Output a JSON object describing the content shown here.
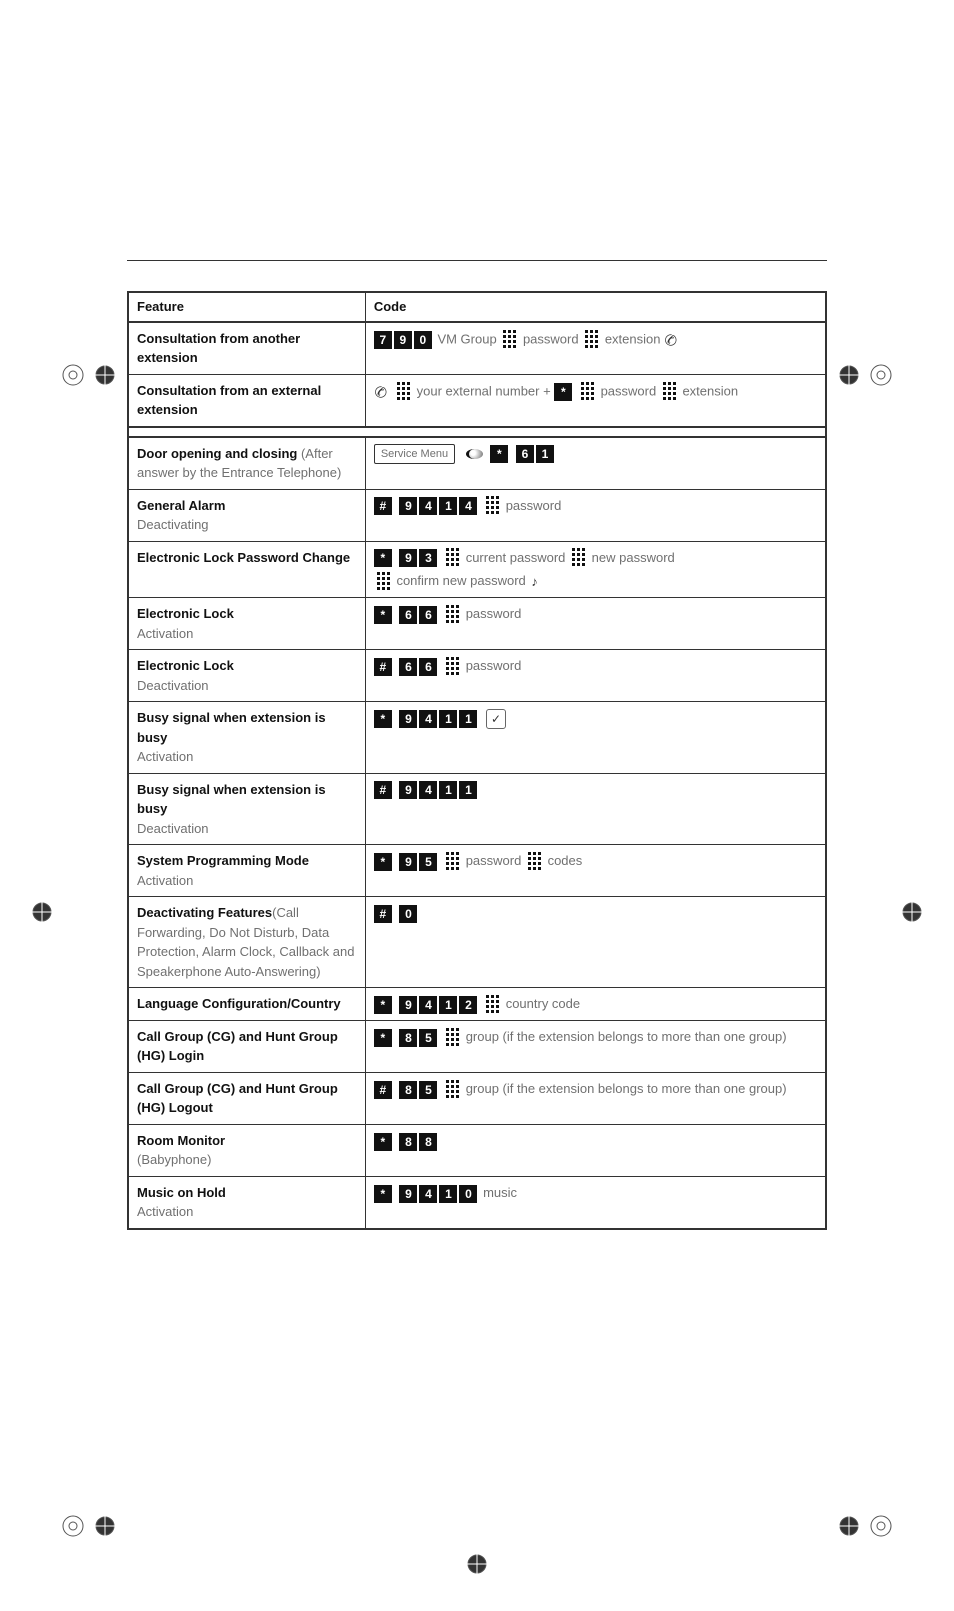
{
  "header": {
    "feature": "Feature",
    "code": "Code"
  },
  "labels": {
    "service_menu": "Service Menu",
    "password": "password"
  },
  "rows": [
    {
      "title": "Consultation from another extension",
      "t1": "VM Group",
      "t2": "password",
      "t3": "extension"
    },
    {
      "title": "Consultation from an external extension",
      "t1": "your external number +",
      "t2": "password",
      "t3": "extension"
    },
    {
      "title": "Door opening and closing",
      "sub": " (After answer by the Entrance Telephone)"
    },
    {
      "title": "General Alarm",
      "sub": "Deactivating"
    },
    {
      "title": "Electronic Lock Password Change",
      "t1": "current password",
      "t2": "new password",
      "t3": "confirm new password"
    },
    {
      "title": "Electronic Lock",
      "sub": "Activation"
    },
    {
      "title": "Electronic Lock",
      "sub": "Deactivation"
    },
    {
      "title": "Busy signal when extension is busy",
      "sub": "Activation"
    },
    {
      "title": "Busy signal when extension is busy",
      "sub": "Deactivation"
    },
    {
      "title": "System Programming Mode",
      "sub": "Activation",
      "t1": "codes"
    },
    {
      "title": "Deactivating Features",
      "sub": "(Call Forwarding, Do Not Disturb, Data Protection, Alarm Clock, Callback and Speakerphone Auto-Answering)"
    },
    {
      "title": "Language Configuration/Country",
      "t1": "country code"
    },
    {
      "title": "Call Group (CG) and Hunt Group (HG) Login",
      "t1": "group (if the extension belongs to more than one group)"
    },
    {
      "title": "Call Group (CG) and Hunt Group (HG) Logout",
      "t1": "group (if the extension belongs to more than one group)"
    },
    {
      "title": "Room Monitor",
      "sub": "(Babyphone)"
    },
    {
      "title": "Music on Hold",
      "sub": "Activation",
      "t1": "music"
    }
  ]
}
